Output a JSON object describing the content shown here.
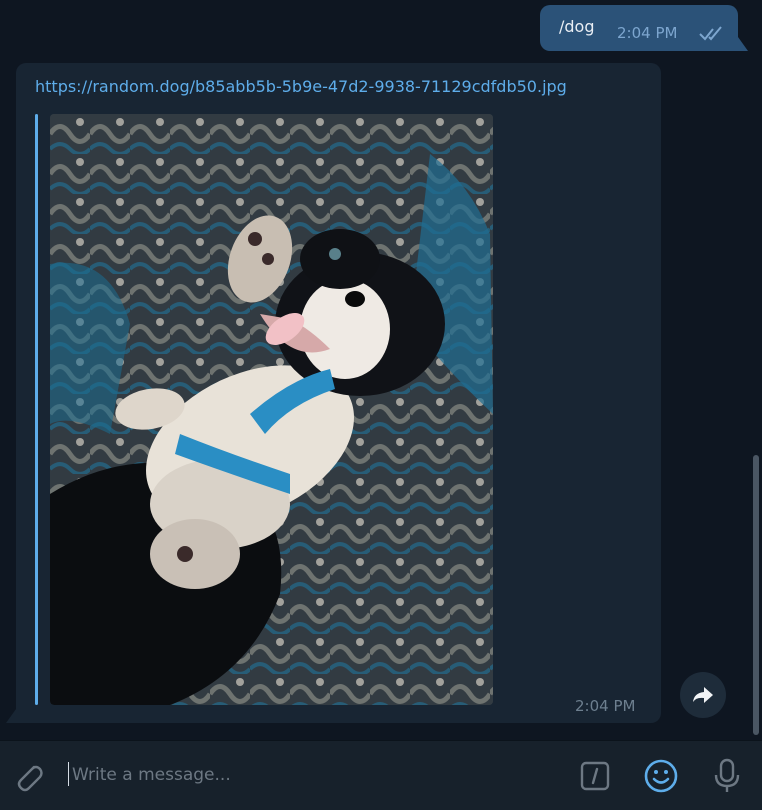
{
  "messages": {
    "outgoing": {
      "text": "/dog",
      "time": "2:04 PM",
      "status": "read"
    },
    "incoming": {
      "link": "https://random.dog/b85abb5b-5b9e-47d2-9938-71129cdfdb50.jpg",
      "time": "2:04 PM",
      "photo": "puppy lying on patterned rug wearing blue harness"
    }
  },
  "composer": {
    "placeholder": "Write a message..."
  },
  "icons": {
    "attach": "paperclip-icon",
    "commands": "slash-command-icon",
    "emoji": "smile-icon",
    "mic": "microphone-icon",
    "forward": "forward-arrow-icon",
    "read": "double-check-icon"
  },
  "colors": {
    "background": "#0e1621",
    "outgoing_bubble": "#2b5278",
    "incoming_bubble": "#182533",
    "accent": "#5eadea",
    "composer": "#17212b"
  }
}
